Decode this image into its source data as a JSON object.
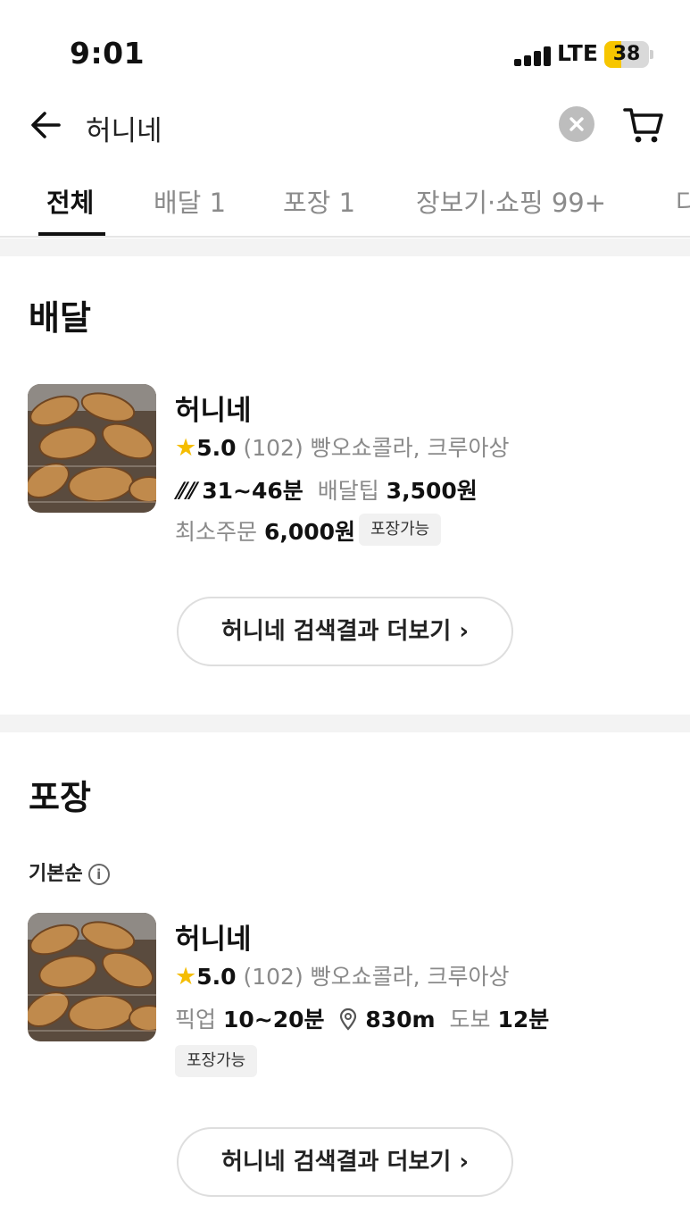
{
  "status_bar": {
    "time": "9:01",
    "network": "LTE",
    "battery": "38",
    "battery_level": 0.38
  },
  "search": {
    "query": "허니네"
  },
  "tabs": [
    {
      "label": "전체",
      "active": true
    },
    {
      "label": "배달 1"
    },
    {
      "label": "포장 1"
    },
    {
      "label": "장보기·쇼핑 99+"
    },
    {
      "label": "다"
    }
  ],
  "delivery": {
    "title": "배달",
    "store": {
      "name": "허니네",
      "rating": "5.0",
      "reviews": "(102)",
      "menu": "빵오쇼콜라, 크루아상",
      "time": "31~46분",
      "tip_label": "배달팁",
      "tip": "3,500원",
      "min_order_label": "최소주문",
      "min_order": "6,000원",
      "badge": "포장가능"
    },
    "more_button": "허니네 검색결과 더보기"
  },
  "takeout": {
    "title": "포장",
    "sort_label": "기본순",
    "store": {
      "name": "허니네",
      "rating": "5.0",
      "reviews": "(102)",
      "menu": "빵오쇼콜라, 크루아상",
      "pickup_label": "픽업",
      "pickup_time": "10~20분",
      "distance": "830m",
      "walk_label": "도보",
      "walk_time": "12분",
      "badge": "포장가능"
    },
    "more_button": "허니네 검색결과 더보기"
  },
  "colors": {
    "star": "#f5bd00",
    "battery": "#f7c600",
    "title_highlight": "#c9f0ee"
  },
  "icons": [
    "back-arrow-icon",
    "clear-icon",
    "cart-icon",
    "star-icon",
    "delivery-rider-icon",
    "location-pin-icon",
    "info-icon",
    "chevron-right-icon"
  ]
}
